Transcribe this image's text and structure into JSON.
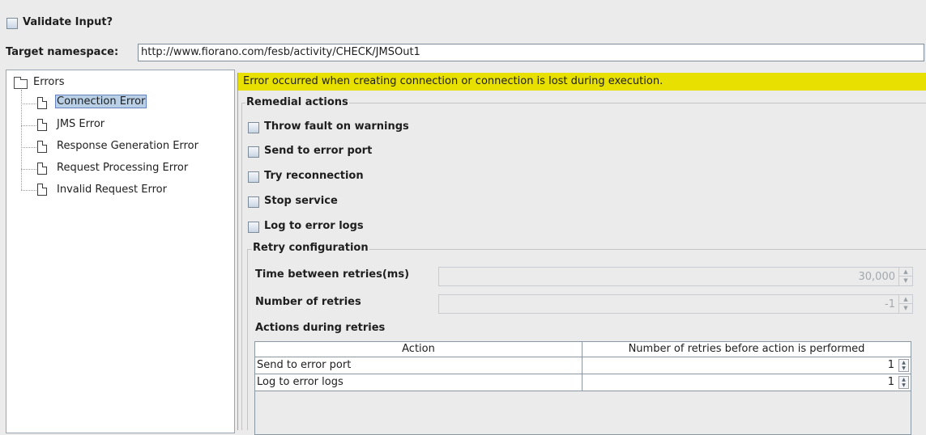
{
  "validate": {
    "label": "Validate Input?",
    "checked": false
  },
  "namespace": {
    "label": "Target namespace:",
    "value": "http://www.fiorano.com/fesb/activity/CHECK/JMSOut1"
  },
  "tree": {
    "root": "Errors",
    "items": [
      {
        "label": "Connection Error",
        "selected": true
      },
      {
        "label": "JMS Error"
      },
      {
        "label": "Response Generation Error"
      },
      {
        "label": "Request Processing Error"
      },
      {
        "label": "Invalid Request Error"
      }
    ]
  },
  "banner": {
    "text": "Error occurred when creating connection or connection is lost during execution.",
    "color": "#e8e000"
  },
  "remedial": {
    "title": "Remedial actions",
    "options": [
      {
        "label": "Throw fault on warnings",
        "checked": false
      },
      {
        "label": "Send to error port",
        "checked": false
      },
      {
        "label": "Try reconnection",
        "checked": false
      },
      {
        "label": "Stop service",
        "checked": false
      },
      {
        "label": "Log to error logs",
        "checked": false
      }
    ]
  },
  "retry": {
    "title": "Retry configuration",
    "time_label": "Time between retries(ms)",
    "time_value": "30,000",
    "count_label": "Number of retries",
    "count_value": "-1",
    "actions_title": "Actions during retries",
    "table": {
      "columns": [
        "Action",
        "Number of retries before action is performed"
      ],
      "rows": [
        {
          "action": "Send to error port",
          "retries": "1"
        },
        {
          "action": "Log to error logs",
          "retries": "1"
        }
      ]
    }
  },
  "icons": {
    "checkbox": "checkbox-icon",
    "folder": "folder-icon",
    "document": "document-icon",
    "spin": "spinner-arrows-icon"
  }
}
